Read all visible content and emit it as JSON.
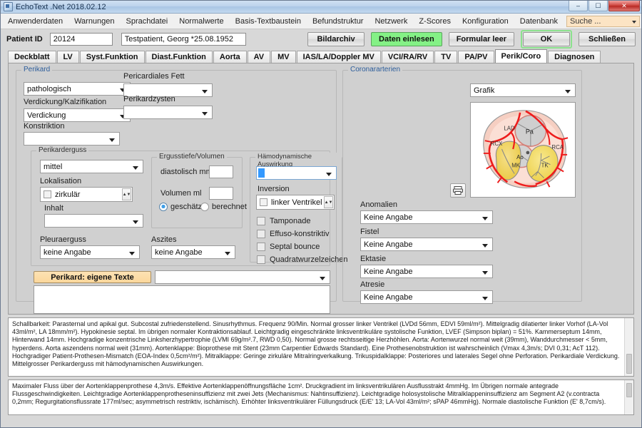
{
  "window": {
    "title": "EchoText .Net 2018.02.12",
    "minimize": "–",
    "maximize": "☐",
    "close": "✕"
  },
  "menu": {
    "items": [
      "Anwenderdaten",
      "Warnungen",
      "Sprachdatei",
      "Normalwerte",
      "Basis-Textbaustein",
      "Befundstruktur",
      "Netzwerk",
      "Z-Scores",
      "Konfiguration",
      "Datenbank"
    ],
    "search_value": "Suche ..."
  },
  "patient": {
    "label": "Patient ID",
    "id": "20124",
    "name": "Testpatient, Georg *25.08.1952",
    "buttons": {
      "bildarchiv": "Bildarchiv",
      "daten_einlesen": "Daten einlesen",
      "formular_leer": "Formular leer",
      "ok": "OK",
      "schliessen": "Schließen"
    }
  },
  "tabs": [
    {
      "label": "Deckblatt",
      "active": false
    },
    {
      "label": "LV",
      "active": false
    },
    {
      "label": "Syst.Funktion",
      "active": false
    },
    {
      "label": "Diast.Funktion",
      "active": false
    },
    {
      "label": "Aorta",
      "active": false
    },
    {
      "label": "AV",
      "active": false
    },
    {
      "label": "MV",
      "active": false
    },
    {
      "label": "IAS/LA/Doppler MV",
      "active": false
    },
    {
      "label": "VCI/RA/RV",
      "active": false
    },
    {
      "label": "TV",
      "active": false
    },
    {
      "label": "PA/PV",
      "active": false
    },
    {
      "label": "Perik/Coro",
      "active": true
    },
    {
      "label": "Diagnosen",
      "active": false
    }
  ],
  "perikard": {
    "group_title": "Perikard",
    "status_value": "pathologisch",
    "pericardiales_fett_label": "Pericardiales Fett",
    "pericardiales_fett_value": "",
    "verdickung_label": "Verdickung/Kalzifikation",
    "verdickung_value": "Verdickung",
    "perikardzysten_label": "Perikardzysten",
    "perikardzysten_value": "",
    "konstriktion_label": "Konstriktion",
    "konstriktion_value": "",
    "erguss": {
      "group_title": "Perikarderguss",
      "grad_value": "mittel",
      "lokalisation_label": "Lokalisation",
      "lokalisation_value": "zirkulär",
      "inhalt_label": "Inhalt",
      "inhalt_value": ""
    },
    "ergusstiefe": {
      "group_title": "Ergusstiefe/Volumen",
      "diastolisch_label": "diastolisch mm",
      "diastolisch_value": "",
      "volumen_label": "Volumen ml",
      "volumen_value": "",
      "radio_geschaetzt": "geschätzt",
      "radio_berechnet": "berechnet",
      "radio_selected": "geschätzt"
    },
    "haemodynamik": {
      "group_title": "Hämodynamische Auswirkung",
      "main_value": "",
      "inversion_label": "Inversion",
      "inversion_value": "linker Ventrikel",
      "checkboxes": [
        "Tamponade",
        "Effuso-konstriktiv",
        "Septal bounce",
        "Quadratwurzelzeichen"
      ]
    },
    "pleuraerguss_label": "Pleuraerguss",
    "pleuraerguss_value": "keine Angabe",
    "aszites_label": "Aszites",
    "aszites_value": "keine Angabe",
    "eigene_texte_button": "Perikard: eigene Texte",
    "eigene_texte_combo_value": "",
    "eigene_texte_area_value": ""
  },
  "coronararterien": {
    "group_title": "Coronararterien",
    "view_value": "Grafik",
    "diagram_labels": [
      "LAD",
      "Pa",
      "RCX",
      "Ao",
      "RCA",
      "MK",
      "TK"
    ],
    "fields": [
      {
        "label": "Anomalien",
        "value": "Keine Angabe"
      },
      {
        "label": "Fistel",
        "value": "Keine Angabe"
      },
      {
        "label": "Ektasie",
        "value": "Keine Angabe"
      },
      {
        "label": "Atresie",
        "value": "Keine Angabe"
      }
    ]
  },
  "report": {
    "findings": "Schallbarkeit: Parasternal und apikal gut. Subcostal zufriedenstellend. Sinusrhythmus. Frequenz 90/Min. Normal grosser linker Ventrikel (LVDd 56mm, EDVI 59ml/m²). Mittelgradig dilatierter linker Vorhof (LA-Vol 43ml/m², LA 18mm/m²). Hypokinesie septal. Im übrigen normaler Kontraktionsablauf. Leichtgradig eingeschränkte linksventrikuläre systolische Funktion, LVEF (Simpson biplan) = 51%. Kammerseptum 14mm, Hinterwand 14mm. Hochgradige konzentrische Linksherzhypertrophie (LVMI 69g/m².7, RWD 0,50). Normal grosse rechtsseitige Herzhöhlen. Aorta: Aortenwurzel normal weit (39mm), Wanddurchmesser < 5mm, hyperdens. Aorta aszendens normal weit (31mm). Aortenklappe: Bioprothese mit Stent (23mm Carpentier Edwards Standard). Eine Prothesenobstruktion ist wahrscheinlich (Vmax 4,3m/s; DVI 0,31; AcT 112). Hochgradiger Patient-Prothesen-Mismatch (EOA-Index 0,5cm²/m²). Mitralklappe: Geringe zirkuläre Mitralringverkalkung. Trikuspidalklappe: Posteriores und laterales Segel ohne Perforation. Perikardiale Verdickung. Mittelgrosser Perikarderguss mit hämodynamischen Auswirkungen.",
    "measurements": "Maximaler Fluss über der Aortenklappenprothese 4,3m/s. Effektive Aortenklappenöffnungsfläche 1cm². Druckgradient im linksventrikulären Ausflusstrakt 4mmHg. Im Übrigen normale antegrade Flussgeschwindigkeiten. Leichtgradige  Aortenklappenprotheseninsuffizienz mit zwei Jets (Mechanismus: Nahtinsuffizienz). Leichtgradige holosystolische Mitralklappeninsuffizienz am Segment A2 (v.contracta 0,2mm; Regurgitationsflussrate 177ml/sec; asymmetrisch restriktiv, ischämisch). Erhöhter linksventrikulärer Füllungsdruck (E/E' 13; LA-Vol 43ml/m²; sPAP 46mmHg). Normale diastolische Funktion (E' 8,7cm/s)."
  }
}
